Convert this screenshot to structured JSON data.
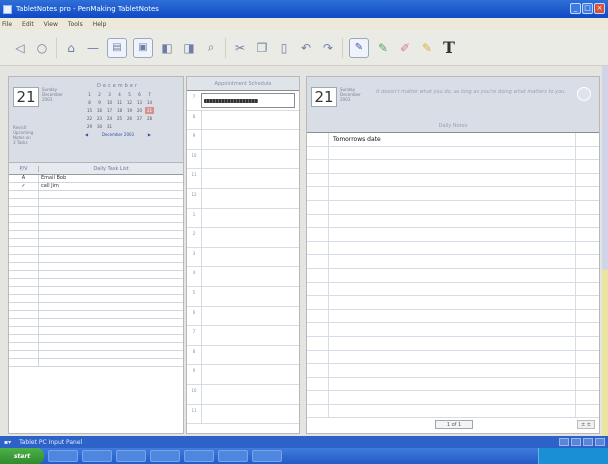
{
  "window": {
    "title": "TabletNotes pro - PenMaking TabletNotes"
  },
  "menu": [
    "File",
    "Edit",
    "View",
    "Tools",
    "Help"
  ],
  "day": {
    "number": "21",
    "meta": [
      "Sunday",
      "December",
      "2003"
    ]
  },
  "mini_calendar": {
    "title": "December",
    "days": [
      "1",
      "2",
      "3",
      "4",
      "5",
      "6",
      "7",
      "8",
      "9",
      "10",
      "11",
      "12",
      "13",
      "14",
      "15",
      "16",
      "17",
      "18",
      "19",
      "20",
      "21",
      "22",
      "23",
      "24",
      "25",
      "26",
      "27",
      "28",
      "29",
      "30",
      "31"
    ],
    "selected": "21",
    "nav_label": "December 2003"
  },
  "ondate": [
    "Revisit",
    "Upcoming",
    "Notes on",
    "3 Tasks"
  ],
  "tasks": {
    "header_priority": "P/V",
    "header_title": "Daily Task List",
    "rows": [
      {
        "p": "A",
        "t": "Email Bob"
      },
      {
        "p": "✓",
        "t": "call Jim"
      }
    ]
  },
  "appointments": {
    "header": "Appointment Schedule",
    "hours": [
      "7",
      "8",
      "9",
      "10",
      "11",
      "12",
      "1",
      "2",
      "3",
      "4",
      "5",
      "6",
      "7",
      "8",
      "9",
      "10",
      "11"
    ]
  },
  "notes": {
    "quote": "It doesn't matter what you do, as long as you're doing what matters to you.",
    "subheader": "Daily Notes",
    "first_line": "Tomorrows date",
    "pager": "1 of 1",
    "zoom": "± ±"
  },
  "input_bar": {
    "label": "Tablet PC Input Panel"
  },
  "taskbar": {
    "start_label": "start"
  }
}
